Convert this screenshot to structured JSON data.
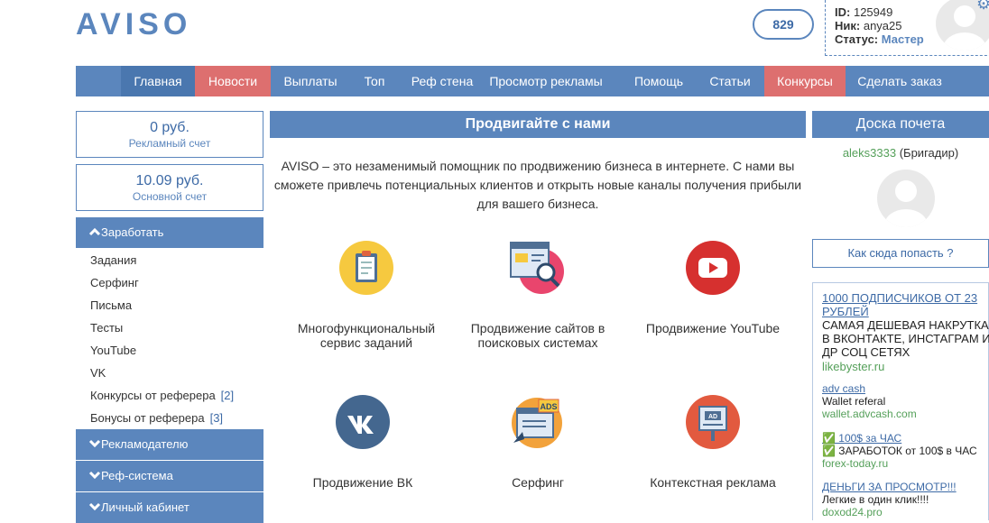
{
  "header": {
    "logo": "AVISO",
    "counter": "829",
    "user": {
      "id_label": "ID:",
      "id_value": "125949",
      "nick_label": "Ник:",
      "nick_value": "anya25",
      "status_label": "Статус:",
      "status_value": "Мастер"
    }
  },
  "nav": [
    "Главная",
    "Новости",
    "Выплаты",
    "Топ",
    "Реф стена",
    "Просмотр рекламы",
    "Помощь",
    "Статьи",
    "Конкурсы",
    "Сделать заказ"
  ],
  "accounts": [
    {
      "amount": "0 руб.",
      "label": "Рекламный счет"
    },
    {
      "amount": "10.09 руб.",
      "label": "Основной счет"
    }
  ],
  "sidebar": {
    "earn_title": "Заработать",
    "earn_items": [
      {
        "label": "Задания",
        "count": ""
      },
      {
        "label": "Серфинг",
        "count": ""
      },
      {
        "label": "Письма",
        "count": ""
      },
      {
        "label": "Тесты",
        "count": ""
      },
      {
        "label": "YouTube",
        "count": ""
      },
      {
        "label": "VK",
        "count": ""
      },
      {
        "label": "Конкурсы от реферера",
        "count": "[2]"
      },
      {
        "label": "Бонусы от реферера",
        "count": "[3]"
      }
    ],
    "sections": [
      "Рекламодателю",
      "Реф-система",
      "Личный кабинет"
    ]
  },
  "promo": {
    "title": "Продвигайте с нами",
    "text": "AVISO – это незаменимый помощник по продвижению бизнеса в интернете. С нами вы сможете привлечь потенциальных клиентов и открыть новые каналы получения прибыли для вашего бизнеса.",
    "features": [
      {
        "icon": "clipboard-icon",
        "caption": "Многофункциональный сервис заданий"
      },
      {
        "icon": "seo-search-icon",
        "caption": "Продвижение сайтов в поисковых системах"
      },
      {
        "icon": "youtube-icon",
        "caption": "Продвижение YouTube"
      },
      {
        "icon": "vk-icon",
        "caption": "Продвижение ВК"
      },
      {
        "icon": "surfing-ads-icon",
        "caption": "Серфинг"
      },
      {
        "icon": "billboard-icon",
        "caption": "Контекстная реклама"
      }
    ]
  },
  "board": {
    "title": "Доска почета",
    "user_name": "aleks3333",
    "user_rank": "(Бригадир)",
    "how_button": "Как сюда попасть ?"
  },
  "ads": [
    {
      "title": "1000 ПОДПИСЧИКОВ ОТ 23 РУБЛЕЙ",
      "desc": "САМАЯ ДЕШЕВАЯ НАКРУТКА В ВКОНТАКТЕ, ИНСТАГРАМ И ДР СОЦ СЕТЯХ",
      "url": "likebyster.ru"
    },
    {
      "title": "adv cash",
      "desc": "Wallet referal",
      "url": "wallet.advcash.com"
    },
    {
      "title": "✅ 100$ за ЧАС",
      "desc": "✅ ЗАРАБОТОК от 100$ в ЧАС",
      "url": "forex-today.ru"
    },
    {
      "title": "ДЕНЬГИ ЗА ПРОСМОТР!!!",
      "desc": "Легкие в один клик!!!!",
      "url": "doxod24.pro"
    }
  ],
  "colors": {
    "primary": "#5b86bd",
    "accent_red": "#dd6f6f",
    "link_green": "#55a05a"
  }
}
